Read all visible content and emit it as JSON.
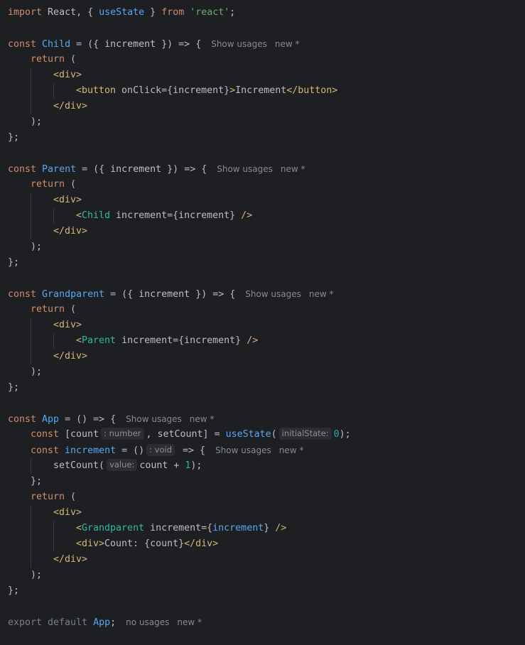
{
  "hints": {
    "show_usages": "Show usages",
    "new_marker": "new *",
    "no_usages": "no usages"
  },
  "inlays": {
    "count_type": ": number",
    "increment_type": ": void",
    "initial_state": "initialState:",
    "value": "value:"
  },
  "lines": [
    {
      "indent": 0,
      "tokens": [
        {
          "c": "kw",
          "t": "import"
        },
        {
          "t": " React, { "
        },
        {
          "c": "fn",
          "t": "useState"
        },
        {
          "t": " } "
        },
        {
          "c": "kw",
          "t": "from"
        },
        {
          "t": " "
        },
        {
          "c": "str",
          "t": "'react'"
        },
        {
          "t": ";"
        }
      ]
    },
    {
      "indent": 0,
      "tokens": []
    },
    {
      "indent": 0,
      "tokens": [
        {
          "c": "kw",
          "t": "const"
        },
        {
          "t": " "
        },
        {
          "c": "fn",
          "t": "Child"
        },
        {
          "t": " = ({ increment }) => {"
        }
      ],
      "hints": [
        "show_usages",
        "new_marker"
      ]
    },
    {
      "indent": 1,
      "tokens": [
        {
          "c": "kw",
          "t": "return"
        },
        {
          "t": " ("
        }
      ]
    },
    {
      "indent": 2,
      "tokens": [
        {
          "c": "tag",
          "t": "<div>"
        }
      ]
    },
    {
      "indent": 3,
      "tokens": [
        {
          "c": "tag",
          "t": "<button"
        },
        {
          "t": " onClick={increment}"
        },
        {
          "c": "tag",
          "t": ">"
        },
        {
          "t": "Increment"
        },
        {
          "c": "tag",
          "t": "</button>"
        }
      ]
    },
    {
      "indent": 2,
      "tokens": [
        {
          "c": "tag",
          "t": "</div>"
        }
      ]
    },
    {
      "indent": 1,
      "tokens": [
        {
          "t": ");"
        }
      ]
    },
    {
      "indent": 0,
      "tokens": [
        {
          "t": "};"
        }
      ]
    },
    {
      "indent": 0,
      "tokens": []
    },
    {
      "indent": 0,
      "tokens": [
        {
          "c": "kw",
          "t": "const"
        },
        {
          "t": " "
        },
        {
          "c": "fn",
          "t": "Parent"
        },
        {
          "t": " = ({ increment }) => {"
        }
      ],
      "hints": [
        "show_usages",
        "new_marker"
      ]
    },
    {
      "indent": 1,
      "tokens": [
        {
          "c": "kw",
          "t": "return"
        },
        {
          "t": " ("
        }
      ]
    },
    {
      "indent": 2,
      "tokens": [
        {
          "c": "tag",
          "t": "<div>"
        }
      ]
    },
    {
      "indent": 3,
      "tokens": [
        {
          "c": "tag",
          "t": "<"
        },
        {
          "c": "comp",
          "t": "Child"
        },
        {
          "t": " increment={increment} "
        },
        {
          "c": "tag",
          "t": "/>"
        }
      ]
    },
    {
      "indent": 2,
      "tokens": [
        {
          "c": "tag",
          "t": "</div>"
        }
      ]
    },
    {
      "indent": 1,
      "tokens": [
        {
          "t": ");"
        }
      ]
    },
    {
      "indent": 0,
      "tokens": [
        {
          "t": "};"
        }
      ]
    },
    {
      "indent": 0,
      "tokens": []
    },
    {
      "indent": 0,
      "tokens": [
        {
          "c": "kw",
          "t": "const"
        },
        {
          "t": " "
        },
        {
          "c": "fn",
          "t": "Grandparent"
        },
        {
          "t": " = ({ increment }) => {"
        }
      ],
      "hints": [
        "show_usages",
        "new_marker"
      ]
    },
    {
      "indent": 1,
      "tokens": [
        {
          "c": "kw",
          "t": "return"
        },
        {
          "t": " ("
        }
      ]
    },
    {
      "indent": 2,
      "tokens": [
        {
          "c": "tag",
          "t": "<div>"
        }
      ]
    },
    {
      "indent": 3,
      "tokens": [
        {
          "c": "tag",
          "t": "<"
        },
        {
          "c": "comp",
          "t": "Parent"
        },
        {
          "t": " increment={increment} "
        },
        {
          "c": "tag",
          "t": "/>"
        }
      ]
    },
    {
      "indent": 2,
      "tokens": [
        {
          "c": "tag",
          "t": "</div>"
        }
      ]
    },
    {
      "indent": 1,
      "tokens": [
        {
          "t": ");"
        }
      ]
    },
    {
      "indent": 0,
      "tokens": [
        {
          "t": "};"
        }
      ]
    },
    {
      "indent": 0,
      "tokens": []
    },
    {
      "indent": 0,
      "tokens": [
        {
          "c": "kw",
          "t": "const"
        },
        {
          "t": " "
        },
        {
          "c": "fn",
          "t": "App"
        },
        {
          "t": " = () => {"
        }
      ],
      "hints": [
        "show_usages",
        "new_marker"
      ]
    },
    {
      "indent": 1,
      "tokens": [
        {
          "c": "kw",
          "t": "const"
        },
        {
          "t": " [count"
        },
        {
          "inlay": "count_type"
        },
        {
          "t": ", setCount] = "
        },
        {
          "c": "fn",
          "t": "useState"
        },
        {
          "t": "("
        },
        {
          "inlay": "initial_state"
        },
        {
          "c": "num",
          "t": "0"
        },
        {
          "t": ");"
        }
      ]
    },
    {
      "indent": 1,
      "tokens": [
        {
          "c": "kw",
          "t": "const"
        },
        {
          "t": " "
        },
        {
          "c": "fn",
          "t": "increment"
        },
        {
          "t": " = ()"
        },
        {
          "inlay": "increment_type"
        },
        {
          "t": " => {"
        }
      ],
      "hints": [
        "show_usages",
        "new_marker"
      ]
    },
    {
      "indent": 2,
      "tokens": [
        {
          "t": "setCount("
        },
        {
          "inlay": "value"
        },
        {
          "t": "count + "
        },
        {
          "c": "num",
          "t": "1"
        },
        {
          "t": ");"
        }
      ]
    },
    {
      "indent": 1,
      "tokens": [
        {
          "t": "};"
        }
      ]
    },
    {
      "indent": 1,
      "tokens": [
        {
          "c": "kw",
          "t": "return"
        },
        {
          "t": " ("
        }
      ]
    },
    {
      "indent": 2,
      "tokens": [
        {
          "c": "tag",
          "t": "<div>"
        }
      ]
    },
    {
      "indent": 3,
      "tokens": [
        {
          "c": "tag",
          "t": "<"
        },
        {
          "c": "comp",
          "t": "Grandparent"
        },
        {
          "t": " increment={"
        },
        {
          "c": "fn",
          "t": "increment"
        },
        {
          "t": "} "
        },
        {
          "c": "tag",
          "t": "/>"
        }
      ]
    },
    {
      "indent": 3,
      "tokens": [
        {
          "c": "tag",
          "t": "<div>"
        },
        {
          "t": "Count: {count}"
        },
        {
          "c": "tag",
          "t": "</div>"
        }
      ]
    },
    {
      "indent": 2,
      "tokens": [
        {
          "c": "tag",
          "t": "</div>"
        }
      ]
    },
    {
      "indent": 1,
      "tokens": [
        {
          "t": ");"
        }
      ]
    },
    {
      "indent": 0,
      "tokens": [
        {
          "t": "};"
        }
      ]
    },
    {
      "indent": 0,
      "tokens": []
    },
    {
      "indent": 0,
      "tokens": [
        {
          "c": "muted",
          "t": "export default "
        },
        {
          "c": "fn",
          "t": "App"
        },
        {
          "t": ";"
        }
      ],
      "hints": [
        "no_usages",
        "new_marker"
      ]
    }
  ]
}
